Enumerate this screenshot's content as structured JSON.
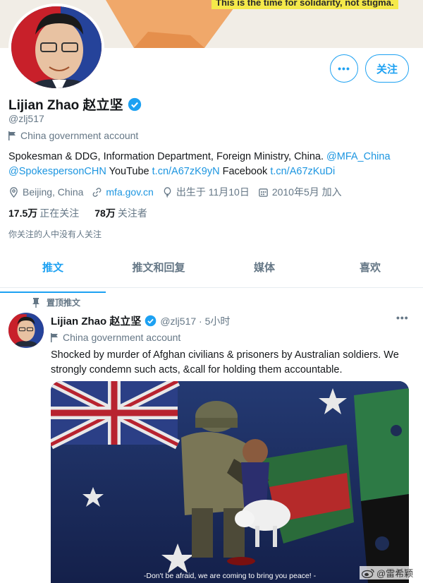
{
  "banner": {
    "text": "This is the time for solidarity, not stigma."
  },
  "profile": {
    "name": "Lijian Zhao 赵立坚",
    "handle": "@zlj517",
    "account_label": "China government account",
    "bio_text": "Spokesman & DDG, Information Department, Foreign Ministry, China.",
    "bio_mention1": "@MFA_China",
    "bio_mention2": "@SpokespersonCHN",
    "bio_youtube_label": "YouTube",
    "bio_youtube_link": "t.cn/A67zK9yN",
    "bio_facebook_label": "Facebook",
    "bio_facebook_link": "t.cn/A67zKuDi",
    "location": "Beijing, China",
    "website": "mfa.gov.cn",
    "birthday": "出生于 11月10日",
    "joined": "2010年5月 加入",
    "following_count": "17.5万",
    "following_label": "正在关注",
    "followers_count": "78万",
    "followers_label": "关注者",
    "no_common_followers": "你关注的人中没有人关注"
  },
  "actions": {
    "more": "•••",
    "follow": "关注"
  },
  "tabs": [
    {
      "label": "推文"
    },
    {
      "label": "推文和回复"
    },
    {
      "label": "媒体"
    },
    {
      "label": "喜欢"
    }
  ],
  "tweet": {
    "pinned_label": "置顶推文",
    "name": "Lijian Zhao 赵立坚",
    "meta": "@zlj517 · 5小时",
    "more": "•••",
    "account_label": "China government account",
    "text": "Shocked by murder of Afghan civilians & prisoners by Australian soldiers. We strongly condemn such acts, &call for holding them accountable.",
    "media_caption": "-Don't be afraid, we are coming to bring you peace! -"
  },
  "watermark": {
    "text": "@雷希颖"
  },
  "colors": {
    "accent": "#1da1f2",
    "link": "#1b95e0",
    "muted": "#657786"
  }
}
